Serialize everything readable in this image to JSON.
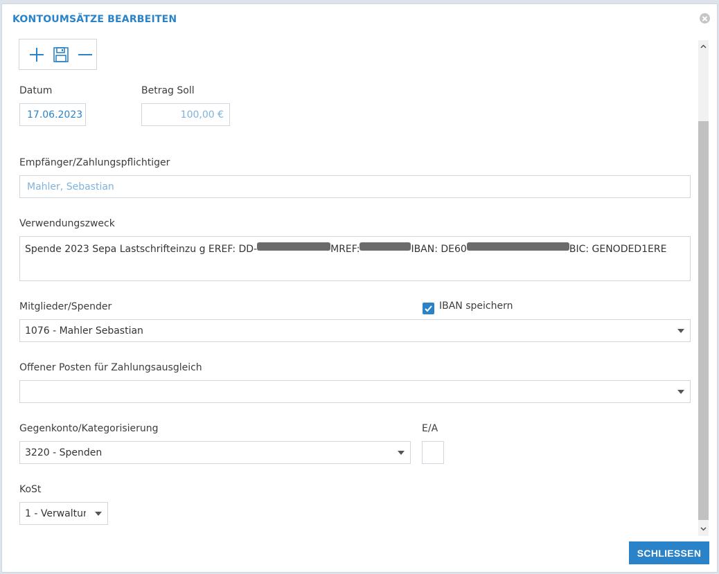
{
  "dialog": {
    "title": "KONTOUMSÄTZE BEARBEITEN",
    "close_icon": "close-circle-icon"
  },
  "toolbar": {
    "icons": [
      "plus-icon",
      "save-icon",
      "minus-icon"
    ]
  },
  "form": {
    "datum_label": "Datum",
    "datum_value": "17.06.2023",
    "betrag_label": "Betrag Soll",
    "betrag_value": "100,00 €",
    "empfaenger_label": "Empfänger/Zahlungspflichtiger",
    "empfaenger_value": "Mahler, Sebastian",
    "verwendung_label": "Verwendungszweck",
    "verwendung_parts": [
      "Spende 2023 Sepa Lastschrifteinzu g EREF: DD-",
      " MREF: ",
      " IBAN: DE60",
      "BIC: GENODED1ERE"
    ],
    "mitglieder_label": "Mitglieder/Spender",
    "mitglieder_value": "1076 - Mahler Sebastian",
    "iban_checkbox_label": "IBAN speichern",
    "iban_checked": true,
    "offener_label": "Offener Posten für Zahlungsausgleich",
    "offener_value": "",
    "gegenkonto_label": "Gegenkonto/Kategorisierung",
    "gegenkonto_value": "3220 - Spenden",
    "ea_label": "E/A",
    "ea_value": "",
    "kost_label": "KoSt",
    "kost_value": "1 - Verwaltun"
  },
  "footer": {
    "close_button": "SCHLIESSEN"
  },
  "colors": {
    "accent": "#2a83c8",
    "border": "#cfd6dd"
  }
}
